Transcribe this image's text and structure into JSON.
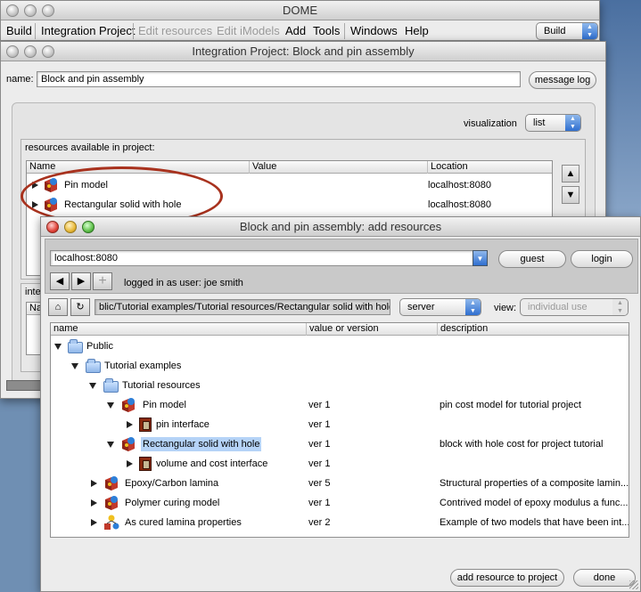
{
  "dome": {
    "title": "DOME",
    "menu": [
      "Build",
      "Integration Project",
      "Edit resources",
      "Edit iModels",
      "Add",
      "Tools",
      "Windows",
      "Help"
    ],
    "mode_select": "Build"
  },
  "project": {
    "title": "Integration Project: Block and pin assembly",
    "name_label": "name:",
    "name_value": "Block and pin assembly",
    "message_log": "message log",
    "visualization_label": "visualization",
    "visualization_value": "list",
    "resources_label": "resources available in project:",
    "columns": [
      "Name",
      "Value",
      "Location"
    ],
    "rows": [
      {
        "name": "Pin  model",
        "location": "localhost:8080"
      },
      {
        "name": "Rectangular solid with hole",
        "location": "localhost:8080"
      }
    ],
    "lower_panel_label_partial": "inte",
    "lower_table_header_partial": "Na"
  },
  "add": {
    "title": "Block and pin assembly: add resources",
    "server_value": "localhost:8080",
    "guest": "guest",
    "login": "login",
    "logged_in": "logged in as user: joe smith",
    "path_value": "blic/Tutorial examples/Tutorial resources/Rectangular solid with hole",
    "location_type": "server",
    "view_label": "view:",
    "view_value": "individual use",
    "columns": [
      "name",
      "value or version",
      "description"
    ],
    "tree": [
      {
        "label": "Public",
        "version": "",
        "desc": ""
      },
      {
        "label": "Tutorial examples",
        "version": "",
        "desc": ""
      },
      {
        "label": "Tutorial resources",
        "version": "",
        "desc": ""
      },
      {
        "label": "Pin  model",
        "version": "ver 1",
        "desc": "pin cost model for tutorial project"
      },
      {
        "label": "pin interface",
        "version": "ver 1",
        "desc": ""
      },
      {
        "label": "Rectangular solid with hole",
        "version": "ver 1",
        "desc": "block with hole cost for project tutorial"
      },
      {
        "label": "volume and cost interface",
        "version": "ver 1",
        "desc": ""
      },
      {
        "label": "Epoxy/Carbon lamina",
        "version": "ver 5",
        "desc": "Structural properties of a composite lamin..."
      },
      {
        "label": "Polymer curing model",
        "version": "ver 1",
        "desc": "Contrived model  of epoxy modulus a func..."
      },
      {
        "label": "As cured lamina properties",
        "version": "ver 2",
        "desc": "Example of two models that have been int..."
      }
    ],
    "add_button": "add resource to project",
    "done_button": "done"
  },
  "colors": {
    "highlight_oval": "#a8321e",
    "selection": "#b5d3f7",
    "accent": "#2f6fd0"
  }
}
